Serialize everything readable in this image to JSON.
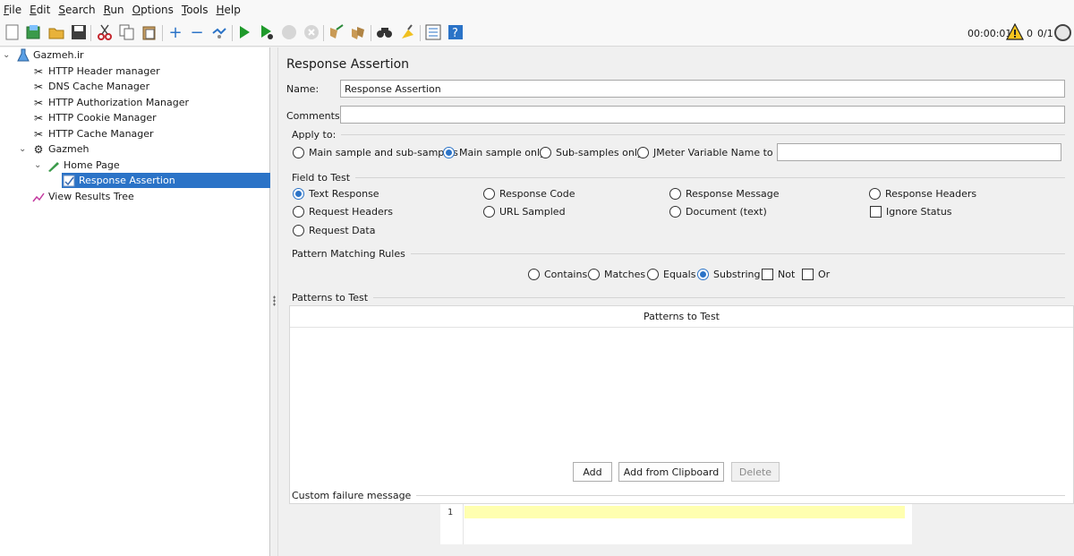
{
  "menu": [
    "File",
    "Edit",
    "Search",
    "Run",
    "Options",
    "Tools",
    "Help"
  ],
  "toolbar": {
    "icons": [
      "new-icon",
      "templates-icon",
      "open-icon",
      "save-icon",
      "cut-icon",
      "copy-icon",
      "paste-icon",
      "expand-icon",
      "collapse-icon",
      "toggle-icon",
      "start-icon",
      "start-no-pause-icon",
      "stop-icon",
      "shutdown-icon",
      "clear-icon",
      "clear-all-icon",
      "search-icon",
      "reset-search-icon",
      "function-helper-icon",
      "help-icon"
    ],
    "timer": "00:00:01",
    "error_count": "0",
    "threads": "0/1"
  },
  "tree": {
    "root": "Gazmeh.ir",
    "items": [
      {
        "label": "HTTP Header manager"
      },
      {
        "label": "DNS Cache Manager"
      },
      {
        "label": "HTTP Authorization Manager"
      },
      {
        "label": "HTTP Cookie Manager"
      },
      {
        "label": "HTTP Cache Manager"
      },
      {
        "label": "Gazmeh"
      },
      {
        "label": "Home Page"
      },
      {
        "label": "Response Assertion"
      },
      {
        "label": "View Results Tree"
      }
    ]
  },
  "panel": {
    "title": "Response Assertion",
    "name_label": "Name:",
    "name_value": "Response Assertion",
    "comments_label": "Comments:",
    "comments_value": "",
    "apply_to": {
      "title": "Apply to:",
      "options": [
        "Main sample and sub-samples",
        "Main sample only",
        "Sub-samples only",
        "JMeter Variable Name to use"
      ],
      "selected": "Main sample only",
      "variable_value": ""
    },
    "field_to_test": {
      "title": "Field to Test",
      "options": [
        "Text Response",
        "Response Code",
        "Response Message",
        "Response Headers",
        "Request Headers",
        "URL Sampled",
        "Document (text)",
        "Ignore Status",
        "Request Data"
      ],
      "selected": "Text Response",
      "ignore_status_checked": false
    },
    "pattern_matching": {
      "title": "Pattern Matching Rules",
      "options": [
        "Contains",
        "Matches",
        "Equals",
        "Substring",
        "Not",
        "Or"
      ],
      "selected": "Substring"
    },
    "patterns": {
      "title": "Patterns to Test",
      "column_header": "Patterns to Test",
      "rows": []
    },
    "buttons": {
      "add": "Add",
      "add_clipboard": "Add from Clipboard",
      "delete": "Delete"
    },
    "custom_failure": {
      "title": "Custom failure message",
      "line_number": "1",
      "value": ""
    }
  },
  "colors": {
    "selection": "#2b73c7",
    "editor_highlight": "#ffffb0"
  }
}
